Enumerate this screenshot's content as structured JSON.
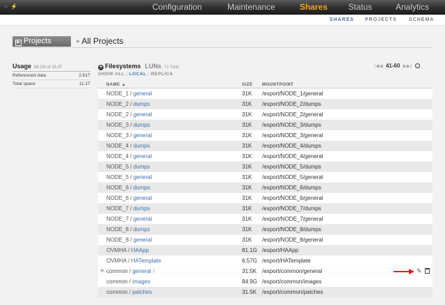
{
  "topbar": {
    "logo": "○ ⚡",
    "nav": [
      {
        "label": "Configuration",
        "active": false
      },
      {
        "label": "Maintenance",
        "active": false
      },
      {
        "label": "Shares",
        "active": true
      },
      {
        "label": "Status",
        "active": false
      },
      {
        "label": "Analytics",
        "active": false
      }
    ]
  },
  "subnav": [
    {
      "label": "SHARES",
      "active": true
    },
    {
      "label": "PROJECTS",
      "active": false
    },
    {
      "label": "SCHEMA",
      "active": false
    }
  ],
  "projects": {
    "tab_label": "Projects",
    "title": "All Projects"
  },
  "usage": {
    "title": "Usage",
    "subtitle": "68.2% of 16.3T",
    "rows": [
      {
        "label": "Referenced data",
        "value": "2.61T"
      },
      {
        "label": "Total space",
        "value": "11.1T"
      }
    ]
  },
  "filesystems": {
    "label": "Filesystems",
    "luns_label": "LUNs",
    "total": "71 Total",
    "filters": [
      "SHOW ALL",
      "LOCAL",
      "REPLICA"
    ],
    "active_filter": "LOCAL",
    "pager": {
      "range": "41-60"
    }
  },
  "table": {
    "columns": [
      "NAME ▲",
      "SIZE",
      "MOUNTPOINT"
    ],
    "rows": [
      {
        "project": "NODE_1",
        "fs": "general",
        "size": "31K",
        "mount": "/export/NODE_1/general"
      },
      {
        "project": "NODE_2",
        "fs": "dumps",
        "size": "31K",
        "mount": "/export/NODE_2/dumps"
      },
      {
        "project": "NODE_2",
        "fs": "general",
        "size": "31K",
        "mount": "/export/NODE_2/general"
      },
      {
        "project": "NODE_3",
        "fs": "dumps",
        "size": "31K",
        "mount": "/export/NODE_3/dumps"
      },
      {
        "project": "NODE_3",
        "fs": "general",
        "size": "31K",
        "mount": "/export/NODE_3/general"
      },
      {
        "project": "NODE_4",
        "fs": "dumps",
        "size": "31K",
        "mount": "/export/NODE_4/dumps"
      },
      {
        "project": "NODE_4",
        "fs": "general",
        "size": "31K",
        "mount": "/export/NODE_4/general"
      },
      {
        "project": "NODE_5",
        "fs": "dumps",
        "size": "31K",
        "mount": "/export/NODE_5/dumps"
      },
      {
        "project": "NODE_5",
        "fs": "general",
        "size": "31K",
        "mount": "/export/NODE_5/general"
      },
      {
        "project": "NODE_6",
        "fs": "dumps",
        "size": "31K",
        "mount": "/export/NODE_6/dumps"
      },
      {
        "project": "NODE_6",
        "fs": "general",
        "size": "31K",
        "mount": "/export/NODE_6/general"
      },
      {
        "project": "NODE_7",
        "fs": "dumps",
        "size": "31K",
        "mount": "/export/NODE_7/dumps"
      },
      {
        "project": "NODE_7",
        "fs": "general",
        "size": "31K",
        "mount": "/export/NODE_7/general"
      },
      {
        "project": "NODE_8",
        "fs": "dumps",
        "size": "31K",
        "mount": "/export/NODE_8/dumps"
      },
      {
        "project": "NODE_8",
        "fs": "general",
        "size": "31K",
        "mount": "/export/NODE_8/general"
      },
      {
        "project": "OVMHA",
        "fs": "HAApp",
        "size": "81.1G",
        "mount": "/export/HAApp"
      },
      {
        "project": "OVMHA",
        "fs": "HATemplate",
        "size": "6.57G",
        "mount": "/export/HATemplate"
      },
      {
        "project": "common",
        "fs": "general",
        "size": "31.5K",
        "mount": "/export/common/general",
        "hover": true
      },
      {
        "project": "common",
        "fs": "images",
        "size": "84.9G",
        "mount": "/export/common/images"
      },
      {
        "project": "common",
        "fs": "patches",
        "size": "31.5K",
        "mount": "/export/common/patches"
      }
    ]
  },
  "colors": {
    "accent": "#f5a623",
    "link": "#3e6fa8",
    "annotation_arrow": "#e02020"
  }
}
